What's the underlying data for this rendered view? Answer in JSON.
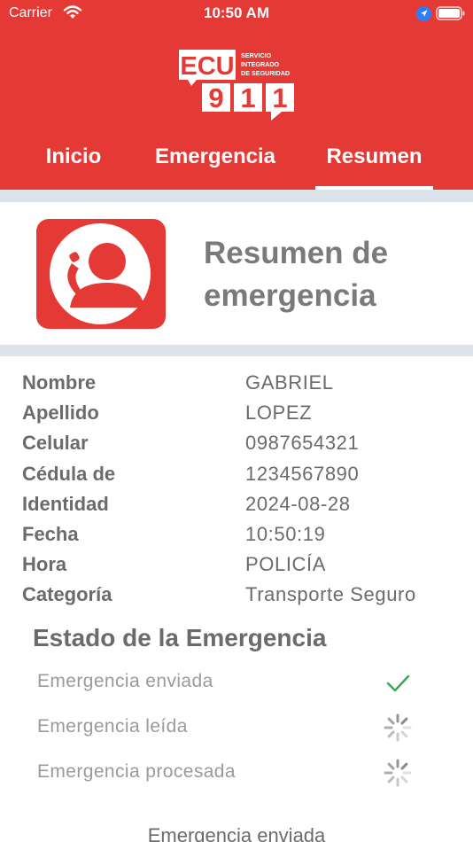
{
  "status_bar": {
    "carrier": "Carrier",
    "time": "10:50 AM"
  },
  "logo": {
    "top": "ECU",
    "number": "911",
    "tagline": [
      "SERVICIO",
      "INTEGRADO",
      "DE SEGURIDAD"
    ]
  },
  "tabs": [
    {
      "label": "Inicio"
    },
    {
      "label": "Emergencia"
    },
    {
      "label": "Resumen",
      "selected": true
    }
  ],
  "summary": {
    "title_line1": "Resumen de",
    "title_line2": "emergencia",
    "icon": "emergency-call-icon"
  },
  "info_rows": [
    {
      "label": "Nombre",
      "value": "GABRIEL"
    },
    {
      "label": "Apellido",
      "value": "LOPEZ"
    },
    {
      "label": "Celular",
      "value": "0987654321"
    },
    {
      "label": "Cédula de",
      "value": "1234567890"
    },
    {
      "label": "Identidad",
      "value": "2024-08-28"
    },
    {
      "label": "Fecha",
      "value": "10:50:19"
    },
    {
      "label": "Hora",
      "value": "POLICÍA"
    },
    {
      "label": "Categoría",
      "value": "Transporte Seguro"
    }
  ],
  "status": {
    "title": "Estado de la Emergencia",
    "items": [
      {
        "label": "Emergencia enviada",
        "state": "done",
        "icon": "checkmark-icon"
      },
      {
        "label": "Emergencia leída",
        "state": "pending",
        "icon": "spinner-icon"
      },
      {
        "label": "Emergencia procesada",
        "state": "pending",
        "icon": "spinner-icon"
      }
    ]
  },
  "footer": {
    "text": "Emergencia enviada"
  },
  "colors": {
    "brand_red": "#e53935",
    "divider": "#dde3ea",
    "check_green": "#3aa655",
    "text_gray": "#6b6b6b"
  }
}
